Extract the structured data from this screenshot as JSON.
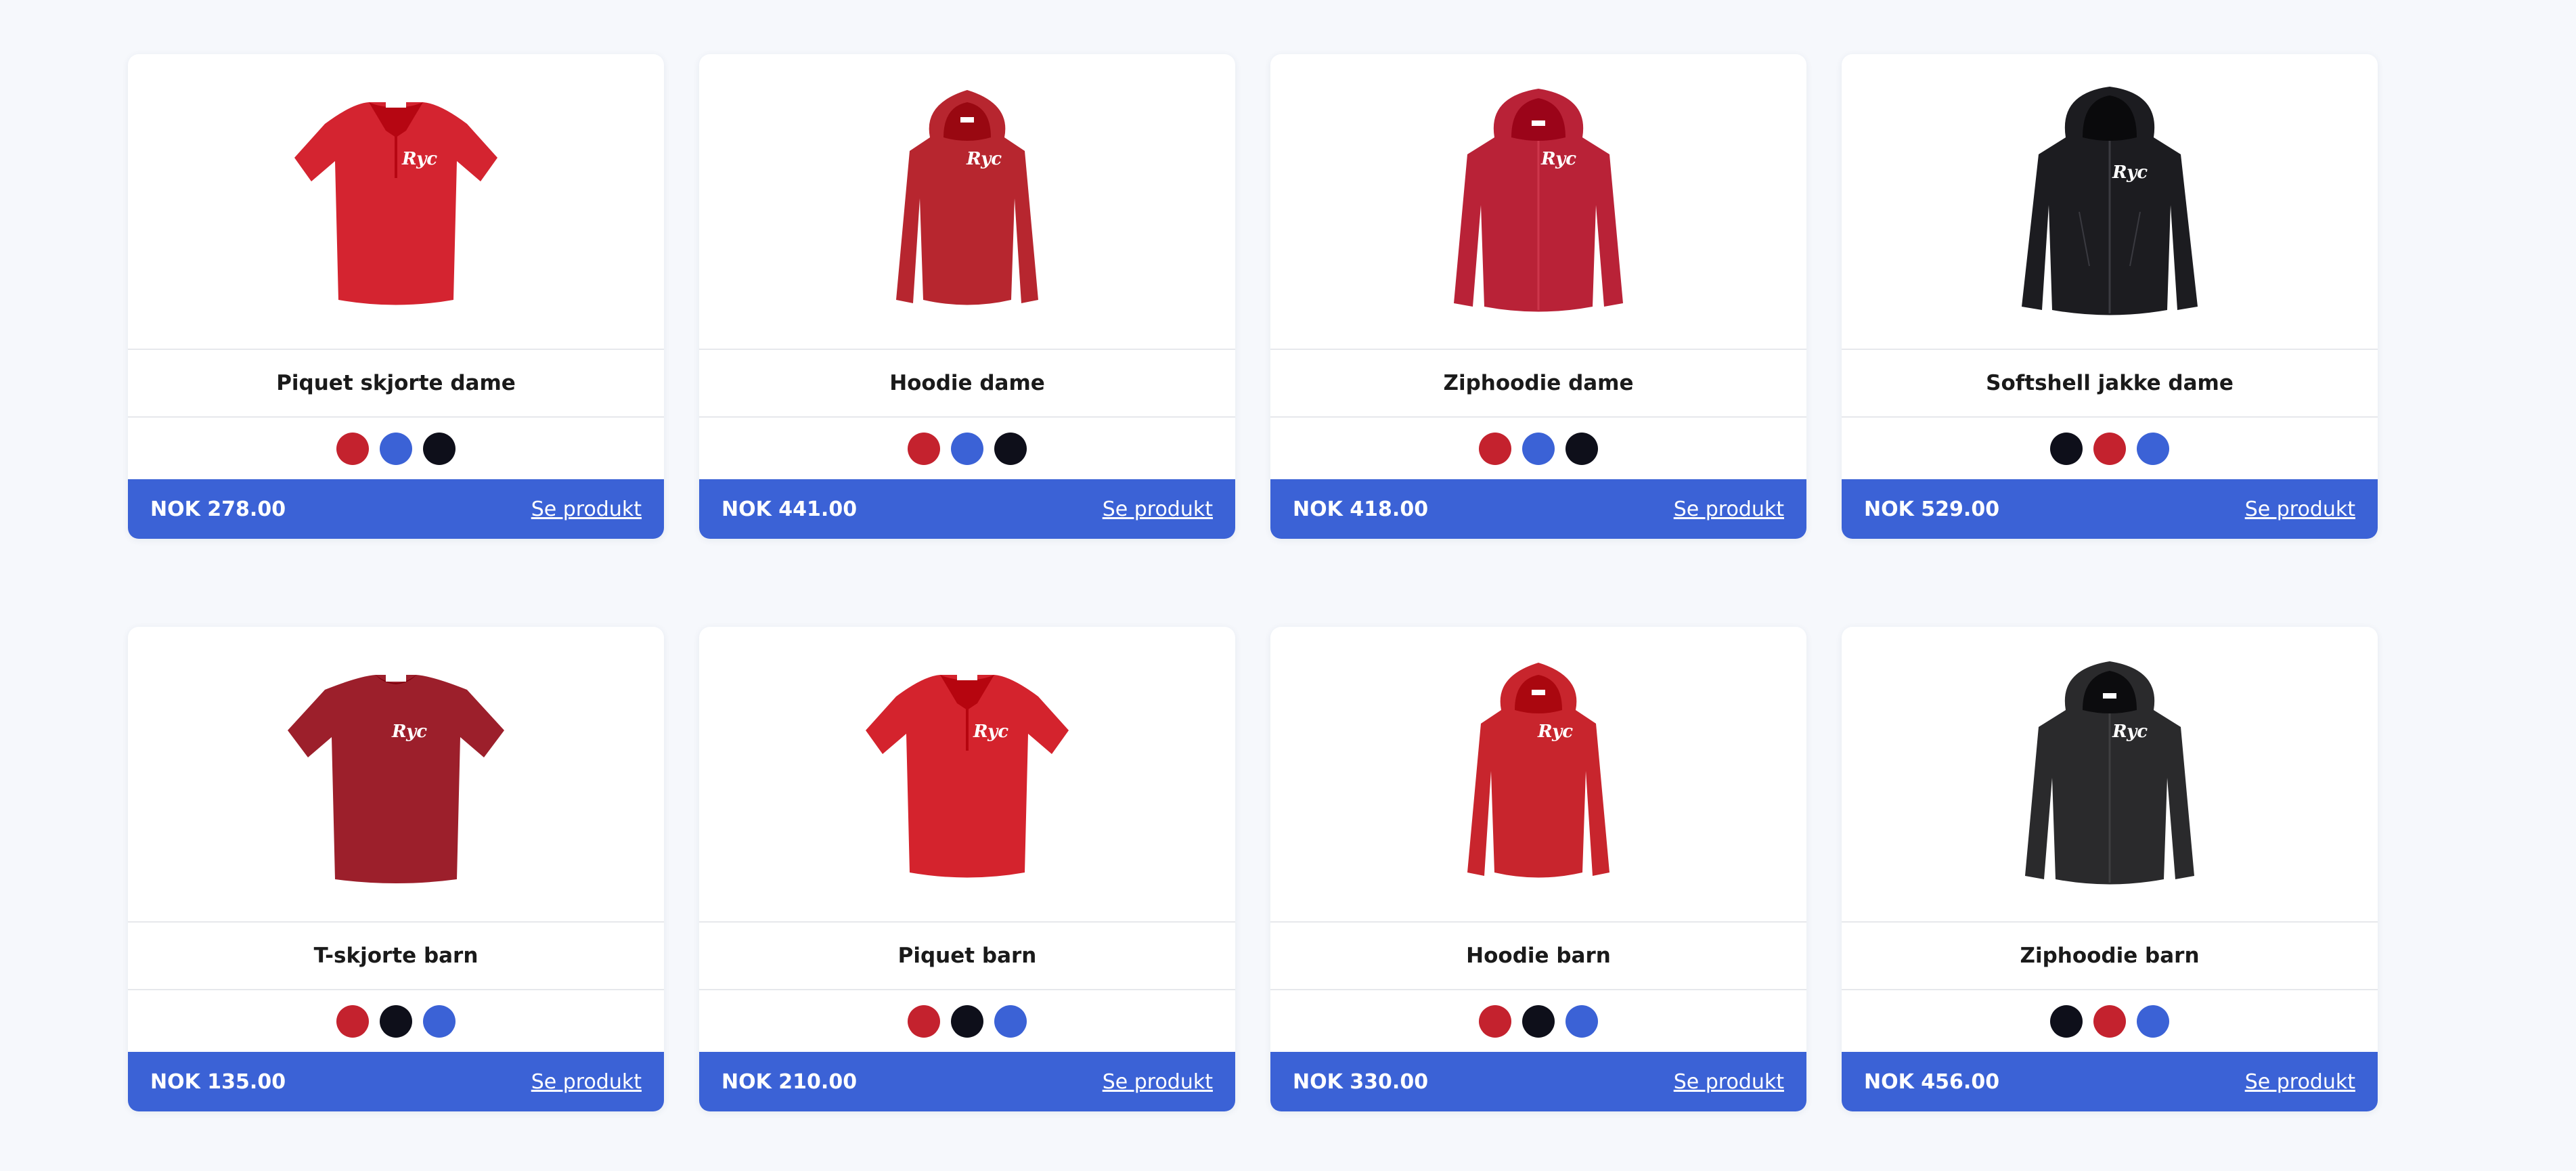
{
  "colors": {
    "red": "#c4222e",
    "blue": "#3b62d6",
    "black": "#0e0f1a",
    "footer": "#3b62d6"
  },
  "products": [
    {
      "name": "Piquet skjorte dame",
      "price": "NOK 278.00",
      "link": "Se produkt",
      "garment": "polo-women",
      "garment_color": "#d42430",
      "swatches": [
        "red",
        "blue",
        "black"
      ],
      "logo": "Ryc"
    },
    {
      "name": "Hoodie dame",
      "price": "NOK 441.00",
      "link": "Se produkt",
      "garment": "hoodie-women",
      "garment_color": "#b7262f",
      "swatches": [
        "red",
        "blue",
        "black"
      ],
      "logo": "Ryc"
    },
    {
      "name": "Ziphoodie dame",
      "price": "NOK 418.00",
      "link": "Se produkt",
      "garment": "ziphoodie",
      "garment_color": "#b92237",
      "swatches": [
        "red",
        "blue",
        "black"
      ],
      "logo": "Ryc"
    },
    {
      "name": "Softshell jakke dame",
      "price": "NOK 529.00",
      "link": "Se produkt",
      "garment": "softshell",
      "garment_color": "#1c1c20",
      "swatches": [
        "black",
        "red",
        "blue"
      ],
      "logo": "Ryc"
    },
    {
      "name": "T-skjorte barn",
      "price": "NOK 135.00",
      "link": "Se produkt",
      "garment": "tshirt",
      "garment_color": "#9c1f2b",
      "swatches": [
        "red",
        "black",
        "blue"
      ],
      "logo": "Ryc"
    },
    {
      "name": "Piquet barn",
      "price": "NOK 210.00",
      "link": "Se produkt",
      "garment": "polo-kids",
      "garment_color": "#d4232d",
      "swatches": [
        "red",
        "black",
        "blue"
      ],
      "logo": "Ryc"
    },
    {
      "name": "Hoodie barn",
      "price": "NOK 330.00",
      "link": "Se produkt",
      "garment": "hoodie-kids",
      "garment_color": "#c8252d",
      "swatches": [
        "red",
        "black",
        "blue"
      ],
      "logo": "Ryc"
    },
    {
      "name": "Ziphoodie barn",
      "price": "NOK 456.00",
      "link": "Se produkt",
      "garment": "ziphoodie-kids",
      "garment_color": "#2a2a2c",
      "swatches": [
        "black",
        "red",
        "blue"
      ],
      "logo": "Ryc"
    }
  ]
}
